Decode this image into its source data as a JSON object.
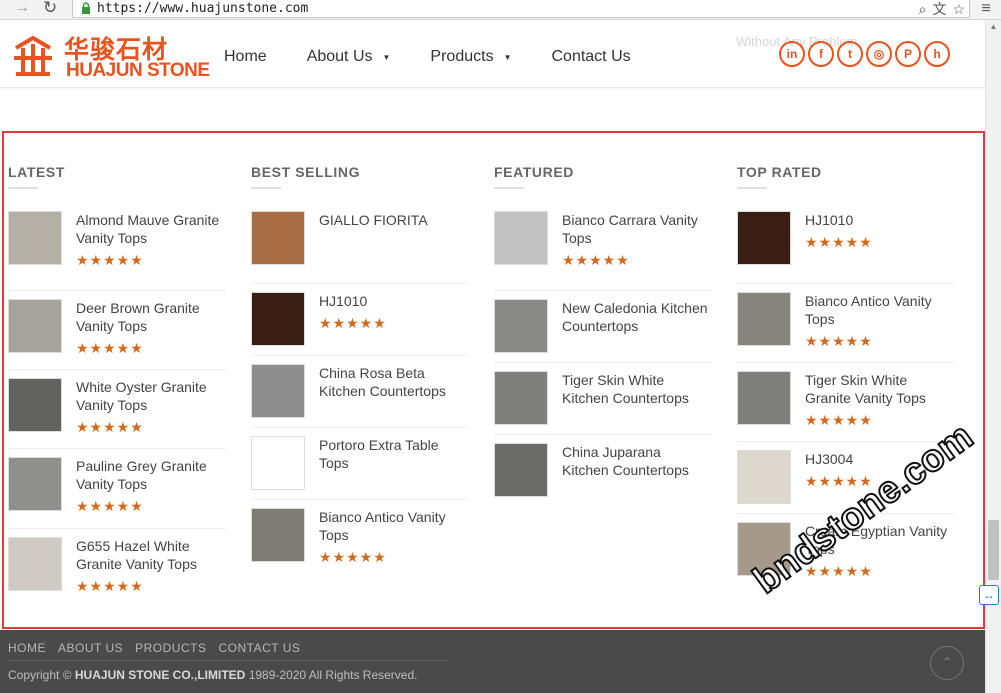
{
  "browser": {
    "url": "https://www.huajunstone.com",
    "forward_glyph": "→",
    "reload_glyph": "↻",
    "zoom_glyph": "⌕",
    "translate_glyph": "文",
    "star_glyph": "☆",
    "menu_glyph": "≡"
  },
  "header": {
    "logo_cn": "华骏石材",
    "logo_en": "HUAJUN STONE",
    "ghost_text": "Without Any Problem",
    "nav": [
      {
        "label": "Home",
        "caret": ""
      },
      {
        "label": "About Us",
        "caret": "▼"
      },
      {
        "label": "Products",
        "caret": "▼"
      },
      {
        "label": "Contact Us",
        "caret": ""
      }
    ],
    "social": [
      {
        "name": "linkedin-icon",
        "glyph": "in"
      },
      {
        "name": "facebook-icon",
        "glyph": "f"
      },
      {
        "name": "twitter-icon",
        "glyph": "t"
      },
      {
        "name": "instagram-icon",
        "glyph": "◎"
      },
      {
        "name": "pinterest-icon",
        "glyph": "P"
      },
      {
        "name": "brand-icon",
        "glyph": "h"
      }
    ],
    "accent_color": "#e8531e"
  },
  "columns": [
    {
      "title": "LATEST",
      "items": [
        {
          "title": "Almond Mauve Granite Vanity Tops",
          "stars": "★★★★★",
          "thumb": "#b4b0a6"
        },
        {
          "title": "Deer Brown Granite Vanity Tops",
          "stars": "★★★★★",
          "thumb": "#a6a29c"
        },
        {
          "title": "White Oyster Granite Vanity Tops",
          "stars": "★★★★★",
          "thumb": "#62625e"
        },
        {
          "title": "Pauline Grey Granite Vanity Tops",
          "stars": "★★★★★",
          "thumb": "#8f8f8d"
        },
        {
          "title": "G655 Hazel White Granite Vanity Tops",
          "stars": "★★★★★",
          "thumb": "#cfcbc4"
        }
      ]
    },
    {
      "title": "BEST SELLING",
      "items": [
        {
          "title": "GIALLO FIORITA",
          "stars": "",
          "thumb": "#a86e42"
        },
        {
          "title": "HJ1010",
          "stars": "★★★★★",
          "thumb": "#3b1e14"
        },
        {
          "title": "China Rosa Beta Kitchen Countertops",
          "stars": "",
          "thumb": "#8e8e8e"
        },
        {
          "title": "Portoro Extra Table Tops",
          "stars": "",
          "thumb": "#ffffff"
        },
        {
          "title": "Bianco Antico Vanity Tops",
          "stars": "★★★★★",
          "thumb": "#7d7d74"
        }
      ]
    },
    {
      "title": "FEATURED",
      "items": [
        {
          "title": "Bianco Carrara Vanity Tops",
          "stars": "★★★★★",
          "thumb": "#c2c2c2"
        },
        {
          "title": "New Caledonia Kitchen Countertops",
          "stars": "",
          "thumb": "#8a8a88"
        },
        {
          "title": "Tiger Skin White Kitchen Countertops",
          "stars": "",
          "thumb": "#7f7f7d"
        },
        {
          "title": "China Juparana Kitchen Countertops",
          "stars": "",
          "thumb": "#6c6c6a"
        }
      ]
    },
    {
      "title": "TOP RATED",
      "items": [
        {
          "title": "HJ1010",
          "stars": "★★★★★",
          "thumb": "#3b1e14"
        },
        {
          "title": "Bianco Antico Vanity Tops",
          "stars": "★★★★★",
          "thumb": "#86857c"
        },
        {
          "title": "Tiger Skin White Granite Vanity Tops",
          "stars": "★★★★★",
          "thumb": "#7f7f7d"
        },
        {
          "title": "HJ3004",
          "stars": "★★★★★",
          "thumb": "#ddd8cd"
        },
        {
          "title": "Cream Egyptian Vanity Tops",
          "stars": "★★★★★",
          "thumb": "#a6998a"
        }
      ]
    }
  ],
  "footer": {
    "links": [
      "HOME",
      "ABOUT US",
      "PRODUCTS",
      "CONTACT US"
    ],
    "copyright_prefix": "Copyright ©",
    "company": "HUAJUN STONE CO.,LIMITED",
    "copyright_suffix": "1989-2020 All Rights Reserved.",
    "back_top_glyph": "⌃"
  },
  "watermark": "bndstone.com",
  "side_widget_glyph": "↔",
  "highlight_color": "#e53935"
}
